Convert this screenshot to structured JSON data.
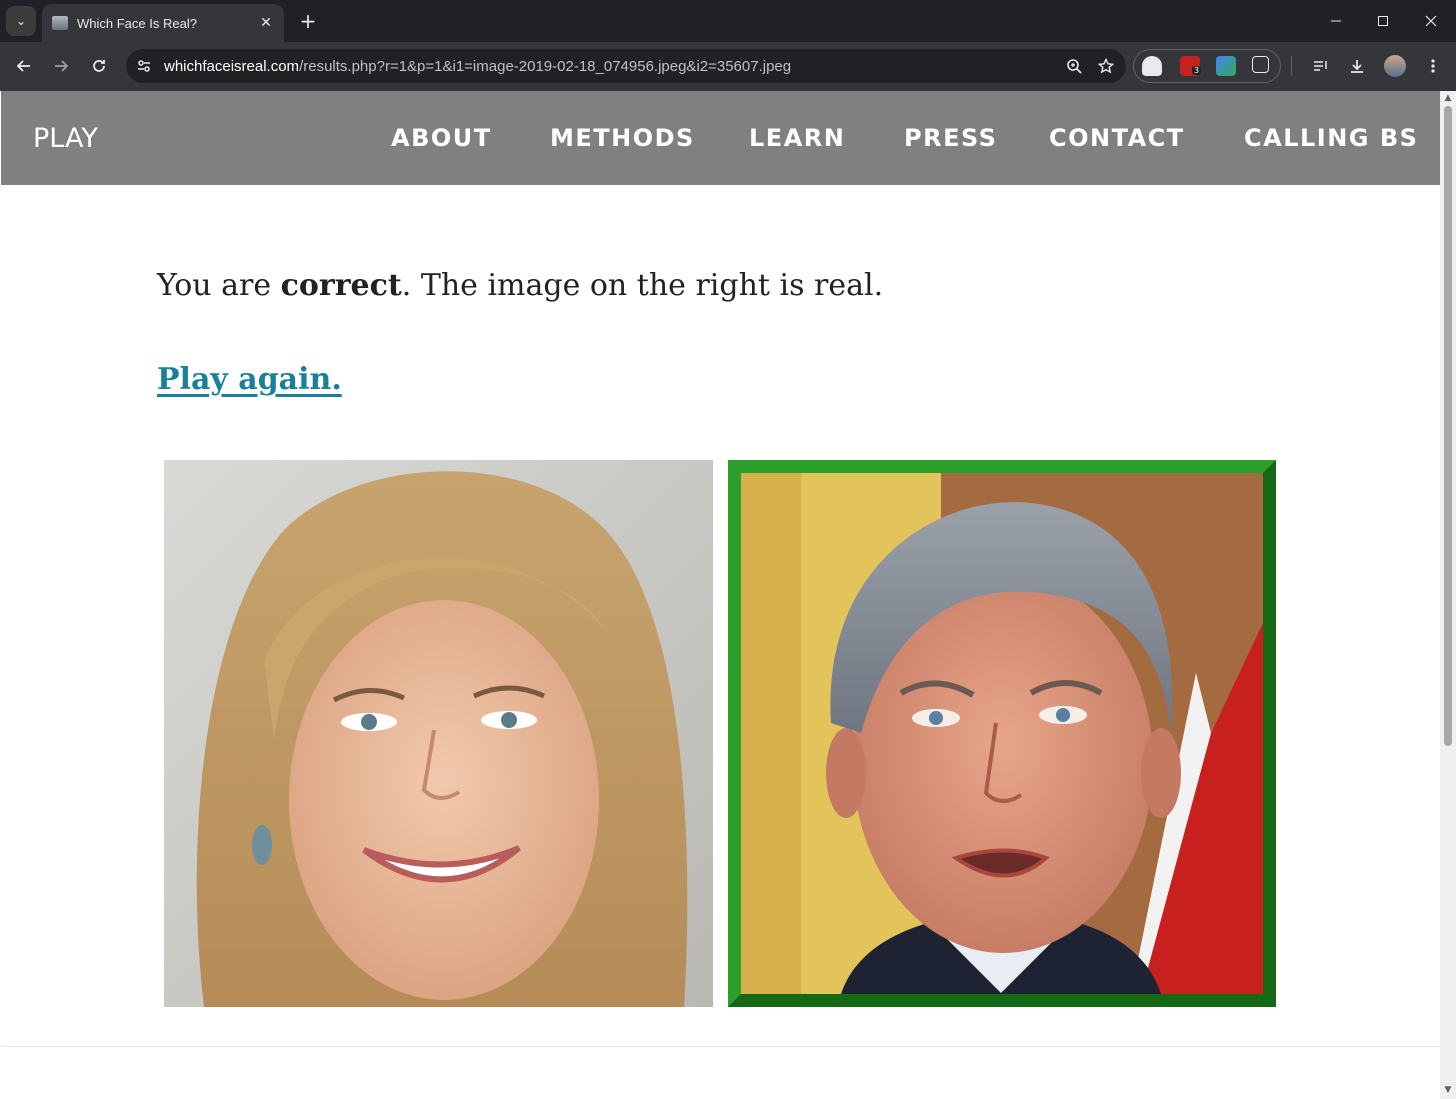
{
  "browser": {
    "tab_title": "Which Face Is Real?",
    "tab_close": "✕",
    "new_tab": "+",
    "url_domain": "whichfaceisreal.com",
    "url_path": "/results.php?r=1&p=1&i1=image-2019-02-18_074956.jpeg&i2=35607.jpeg",
    "icons": [
      "tab-search-icon",
      "back-icon",
      "forward-icon",
      "reload-icon",
      "tune-icon",
      "zoom-icon",
      "star-icon",
      "extensions-icon",
      "media-icon",
      "download-icon",
      "profile-avatar",
      "menu-icon"
    ],
    "extension_badge": "3"
  },
  "nav": {
    "play": "PLAY",
    "items": [
      "ABOUT",
      "METHODS",
      "LEARN",
      "PRESS",
      "CONTACT",
      "CALLING BS"
    ]
  },
  "result": {
    "prefix": "You are ",
    "verdict": "correct",
    "suffix": ". The image on the right is real."
  },
  "play_again": "Play again.",
  "images": {
    "left": "AI-generated face photo of a smiling blonde woman",
    "right": "Real photo of a grey-haired man, highlighted with green frame",
    "right_highlight_color": "#1e8c1e"
  },
  "colors": {
    "nav_bg": "#808080",
    "link": "#1a7f9a",
    "browser_chrome": "#35363a"
  }
}
